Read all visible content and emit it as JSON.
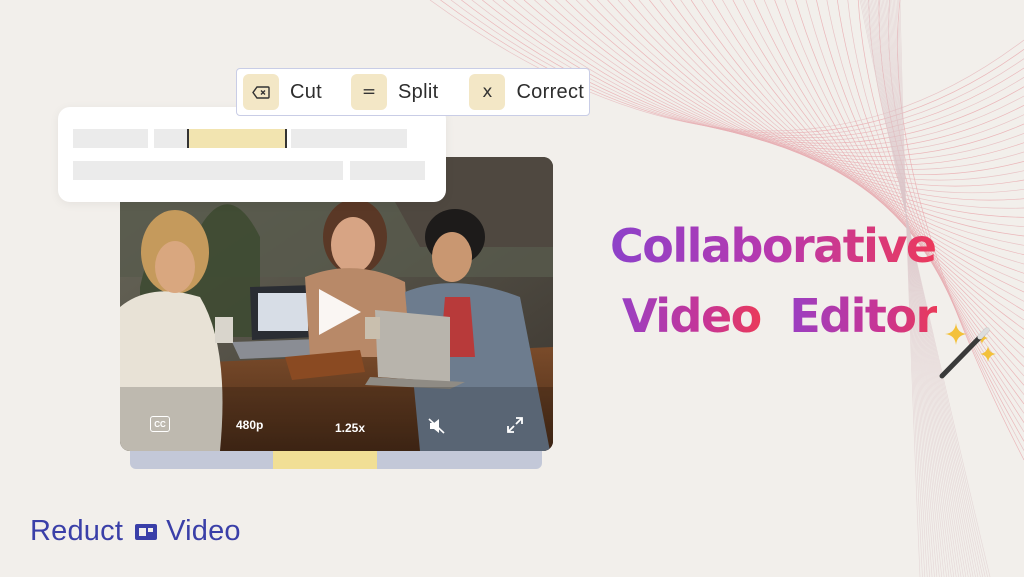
{
  "toolbar": {
    "cut": {
      "label": "Cut",
      "key_icon": "backspace-icon"
    },
    "split": {
      "label": "Split",
      "key_glyph": "="
    },
    "correct": {
      "label": "Correct",
      "key_glyph": "x"
    }
  },
  "player": {
    "cc_label": "CC",
    "resolution": "480p",
    "speed": "1.25x",
    "icons": [
      "play-icon",
      "mute-icon",
      "fullscreen-icon"
    ]
  },
  "headline": {
    "line1": "Collaborative",
    "line2a": "Video",
    "line2b": "Editor"
  },
  "logo": {
    "word1": "Reduct",
    "word2": "Video"
  },
  "colors": {
    "background": "#f2efeb",
    "accent_yellow": "#f1df95",
    "toolbar_border": "#c9cde6",
    "brand_blue": "#3a3fa8",
    "headline_gradient": [
      "#8d41c9",
      "#ec3a5b"
    ]
  }
}
